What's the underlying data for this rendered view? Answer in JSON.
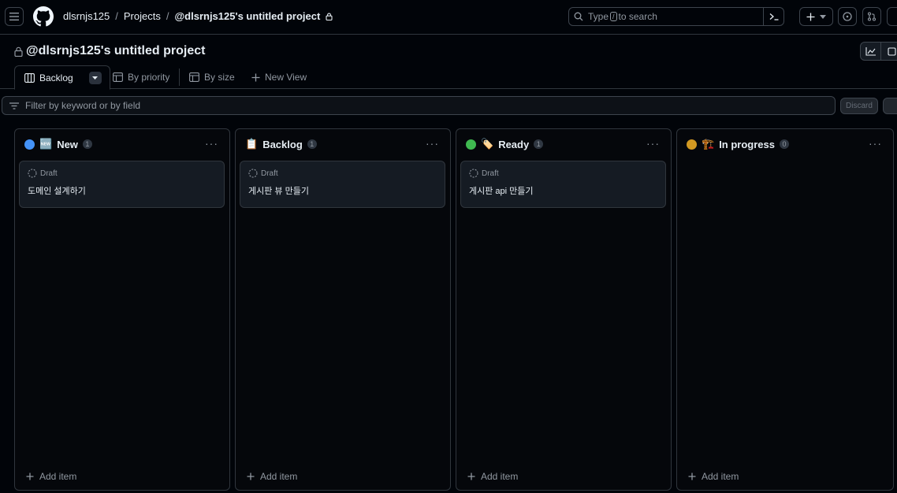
{
  "header": {
    "owner": "dlsrnjs125",
    "projects_label": "Projects",
    "project": "@dlsrnjs125's untitled project",
    "search_type": "Type",
    "search_key": "/",
    "search_rest": "to search"
  },
  "project_title": "@dlsrnjs125's untitled project",
  "views": [
    {
      "label": "Backlog"
    },
    {
      "label": "By priority"
    },
    {
      "label": "By size"
    },
    {
      "label": "New View"
    }
  ],
  "filter": {
    "placeholder": "Filter by keyword or by field",
    "discard_label": "Discard"
  },
  "columns": [
    {
      "name": "New",
      "emoji": "🆕",
      "count": "1",
      "dot_color": "#4493f8",
      "cards": [
        {
          "status": "Draft",
          "title": "도메인 설계하기"
        }
      ],
      "add_label": "Add item"
    },
    {
      "name": "Backlog",
      "emoji": "📋",
      "count": "1",
      "dot_color": "",
      "cards": [
        {
          "status": "Draft",
          "title": "게시판 뷰 만들기"
        }
      ],
      "add_label": "Add item"
    },
    {
      "name": "Ready",
      "emoji": "🏷️",
      "count": "1",
      "dot_color": "#3fb950",
      "cards": [
        {
          "status": "Draft",
          "title": "게시판 api 만들기"
        }
      ],
      "add_label": "Add item"
    },
    {
      "name": "In progress",
      "emoji": "🏗️",
      "count": "0",
      "dot_color": "#d29922",
      "cards": [],
      "add_label": "Add item"
    }
  ]
}
